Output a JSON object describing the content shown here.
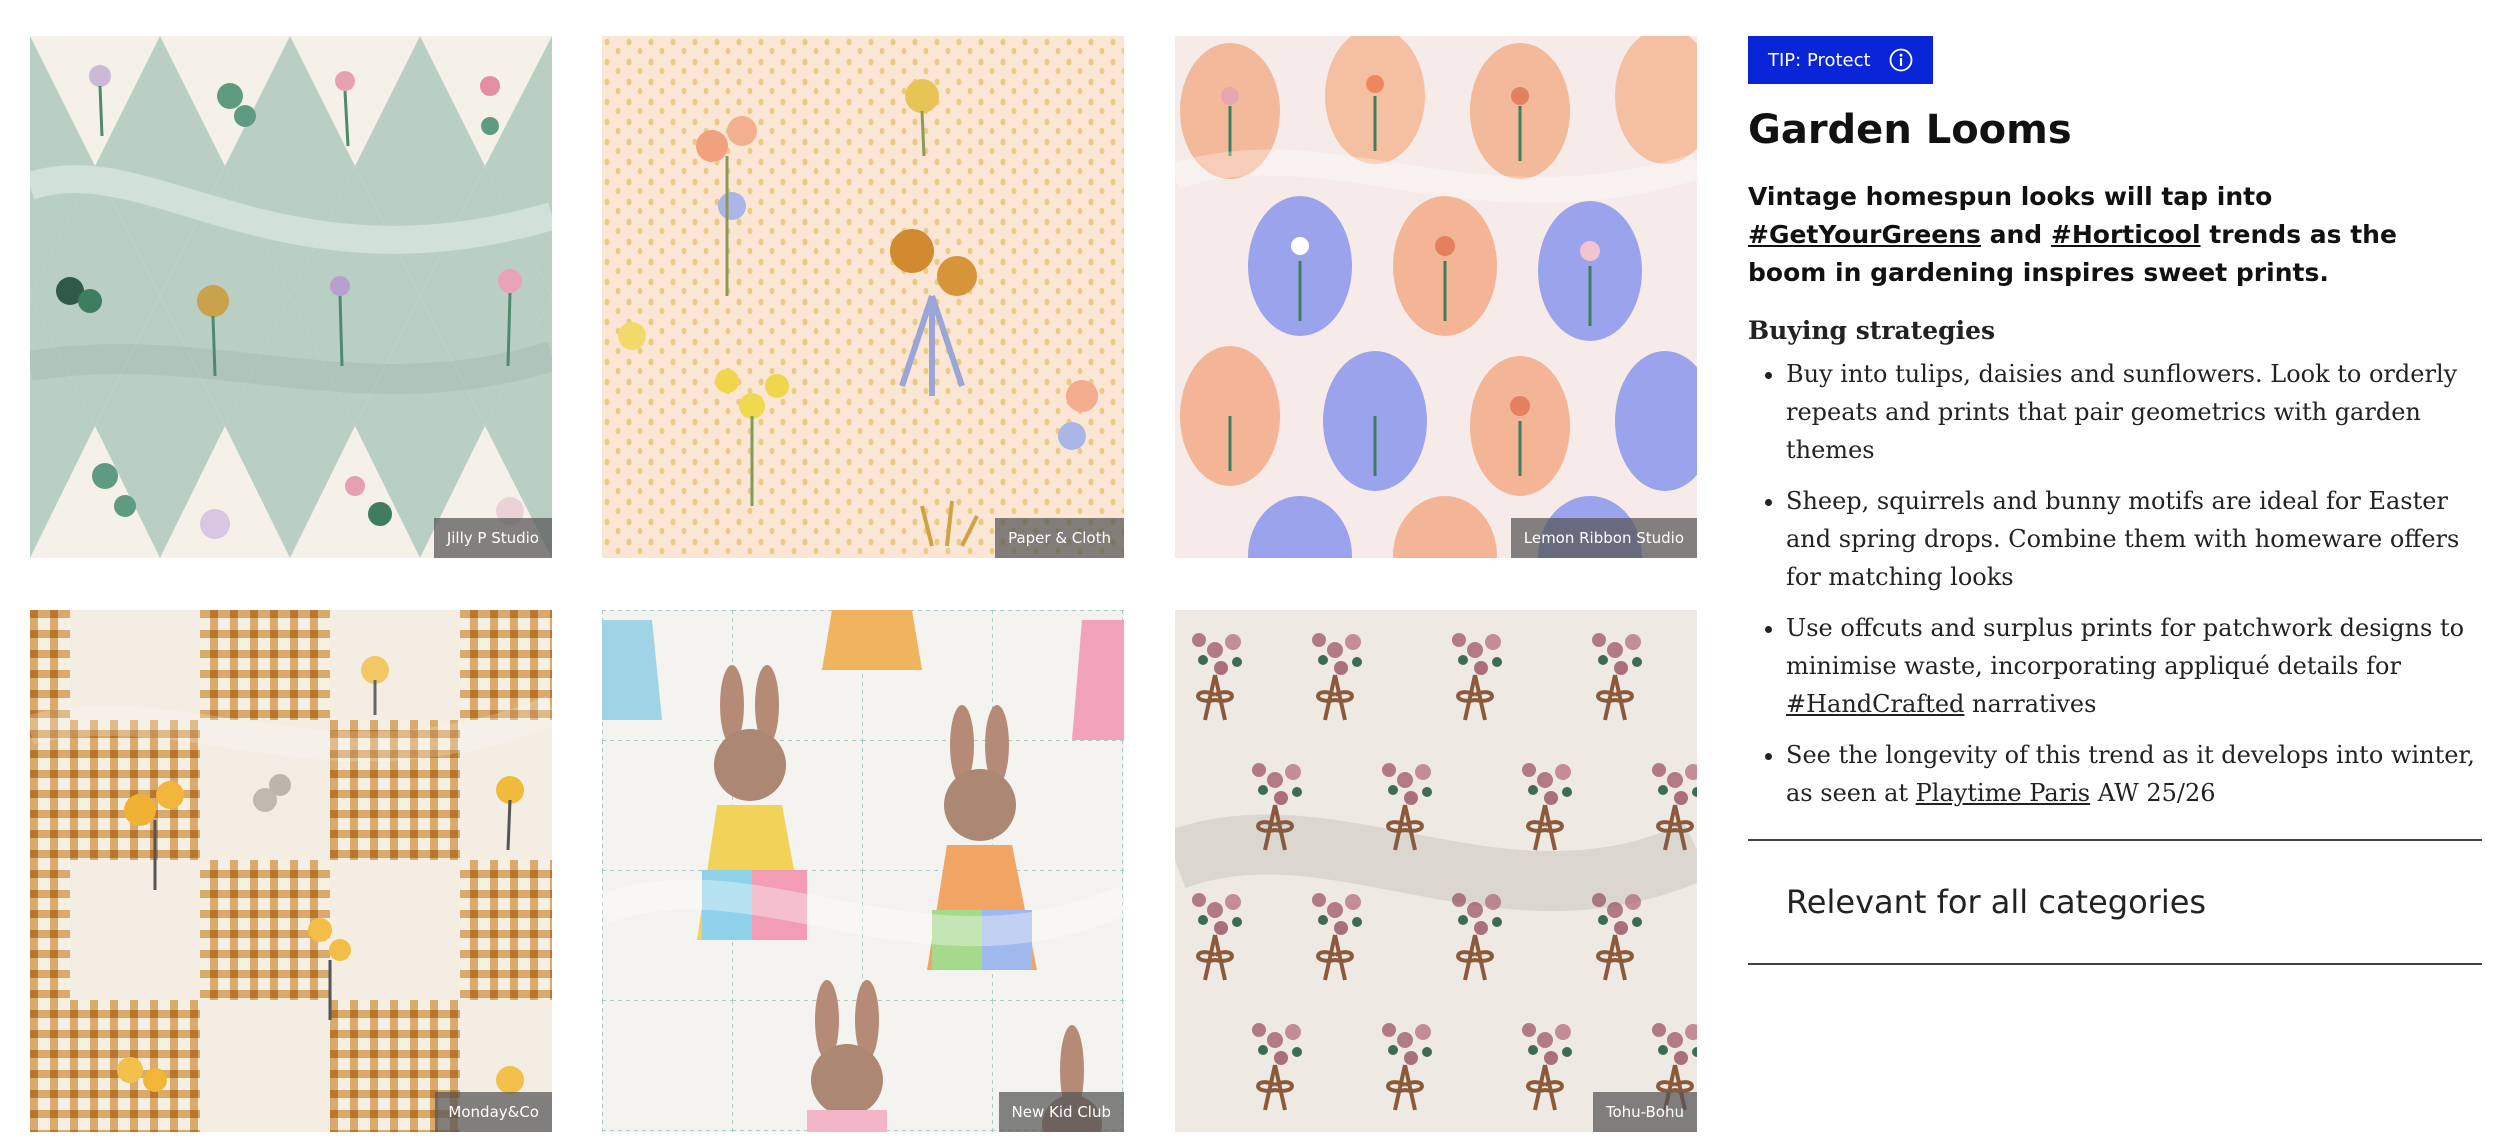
{
  "gallery": [
    {
      "credit": "Jilly P Studio",
      "pattern": "harlequin-diamond-florals",
      "colors": {
        "bg": "#f6f1e8",
        "accent": "#b7cdc3"
      }
    },
    {
      "credit": "Paper & Cloth",
      "pattern": "dotted-wildflowers",
      "colors": {
        "bg": "#fbe6d6",
        "accent": "#e7c26a"
      }
    },
    {
      "credit": "Lemon Ribbon Studio",
      "pattern": "oval-posies",
      "colors": {
        "bg": "#f7ebe9",
        "accent": "#9fa6ea"
      }
    },
    {
      "credit": "Monday&Co",
      "pattern": "gingham-florals",
      "colors": {
        "bg": "#f3ede4",
        "accent": "#c98a3a"
      }
    },
    {
      "credit": "New Kid Club",
      "pattern": "patchwork-bunnies",
      "colors": {
        "bg": "#f4f3ef",
        "accent": "#a77f6a"
      }
    },
    {
      "credit": "Tohu-Bohu",
      "pattern": "bow-bouquets",
      "colors": {
        "bg": "#ece7e2",
        "accent": "#8b5a3a"
      }
    }
  ],
  "tip": {
    "label": "TIP: Protect",
    "icon": "info-circle-icon"
  },
  "trend": {
    "title": "Garden Looms",
    "lead": {
      "part1": "Vintage homespun looks will tap into ",
      "link1": "#GetYourGreens",
      "part2": " and ",
      "link2": "#Horticool",
      "part3": " trends as the boom in gardening inspires sweet prints."
    }
  },
  "buying": {
    "heading": "Buying strategies",
    "items": [
      {
        "text": "Buy into tulips, daisies and sunflowers. Look to orderly repeats and prints that pair geometrics with garden themes"
      },
      {
        "text": "Sheep, squirrels and bunny motifs are ideal for Easter and spring drops. Combine them with homeware offers for matching looks"
      },
      {
        "pre": "Use offcuts and surplus prints for patchwork designs to minimise waste, incorporating appliqué details for ",
        "link": "#HandCrafted",
        "post": " narratives"
      },
      {
        "pre": "See the longevity of this trend as it develops into winter, as seen at ",
        "link": "Playtime Paris",
        "post": " AW 25/26"
      }
    ]
  },
  "relevant": {
    "label": "Relevant for all categories"
  },
  "colors": {
    "tip_bg": "#0a24d8",
    "divider": "#444444"
  }
}
